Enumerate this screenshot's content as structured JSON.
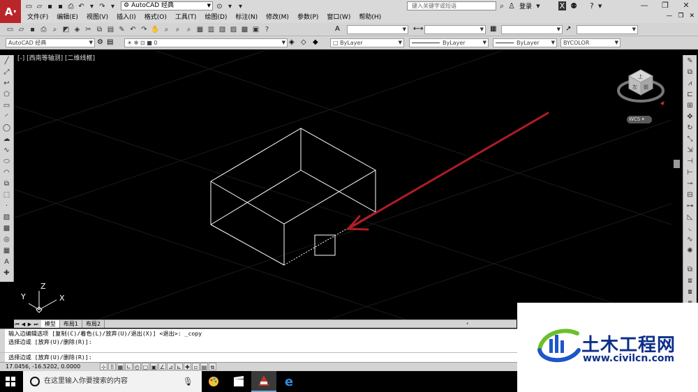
{
  "title_bar": {
    "app_logo": "A",
    "workspace": "AutoCAD 经典",
    "search_placeholder": "键入关键字或短语",
    "login": "登录"
  },
  "menu": {
    "items": [
      "文件(F)",
      "编辑(E)",
      "视图(V)",
      "插入(I)",
      "格式(O)",
      "工具(T)",
      "绘图(D)",
      "标注(N)",
      "修改(M)",
      "参数(P)",
      "窗口(W)",
      "帮助(H)"
    ]
  },
  "toolbar_layer": {
    "workspace_combo": "AutoCAD 经典",
    "layer_value": "0",
    "color": "ByLayer",
    "linetype": "ByLayer",
    "lineweight": "ByLayer",
    "plot_style": "BYCOLOR"
  },
  "viewport": {
    "label": "[-] [西南等轴测] [二维线框]",
    "wcs": "WCS",
    "viewcube_face_left": "左",
    "viewcube_face_right": "前",
    "viewcube_face_top": "上",
    "axis_x": "X",
    "axis_y": "Y",
    "axis_z": "Z",
    "colors": {
      "background": "#000000",
      "geometry": "#ffffff",
      "annotation_arrow": "#b01c25"
    }
  },
  "layout_tabs": {
    "tabs": [
      "模型",
      "布局1",
      "布局2"
    ],
    "active": "模型"
  },
  "command": {
    "history": [
      "输入边编辑选项 [复制(C)/着色(L)/放弃(U)/退出(X)] <退出>: _copy",
      "选择边或 [放弃(U)/删除(R)]:"
    ],
    "prompt": "选择边或 [放弃(U)/删除(R)]:"
  },
  "status": {
    "coordinates": "17.0456, -16.5202, 0.0000"
  },
  "watermark": {
    "title": "土木工程网",
    "url": "www.civilcn.com",
    "colors": {
      "text": "#0d2f8a",
      "accent_green": "#6cbf2a"
    }
  },
  "taskbar": {
    "search_placeholder": "在这里输入你要搜索的内容"
  }
}
